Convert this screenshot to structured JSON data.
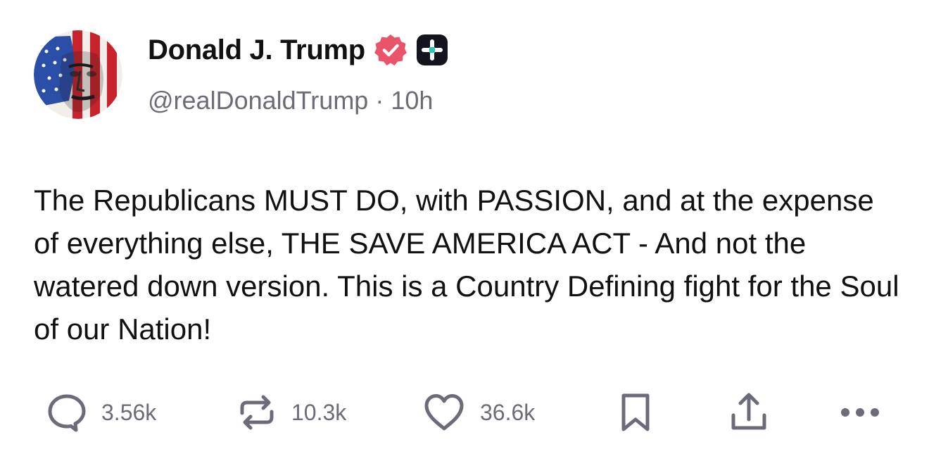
{
  "author": {
    "display_name": "Donald J. Trump",
    "handle": "@realDonaldTrump",
    "separator": "·",
    "time_ago": "10h",
    "avatar_icon": "flag-portrait-avatar",
    "verified_icon": "verified-badge-icon",
    "verified_color": "#e9546b",
    "plus_icon": "plus-badge-icon"
  },
  "post": {
    "text": "The Republicans MUST DO, with PASSION, and at the expense of everything else, THE SAVE AMERICA ACT - And not the watered down version. This is a Country Defining fight for the Soul of our Nation!"
  },
  "actions": {
    "reply": {
      "icon": "reply-bubble-icon",
      "count": "3.56k"
    },
    "repost": {
      "icon": "repost-icon",
      "count": "10.3k"
    },
    "like": {
      "icon": "heart-icon",
      "count": "36.6k"
    },
    "bookmark": {
      "icon": "bookmark-icon"
    },
    "share": {
      "icon": "share-upload-icon"
    },
    "more": {
      "icon": "more-dots-icon"
    }
  },
  "colors": {
    "text": "#111111",
    "muted": "#6c6c78",
    "icon": "#6c6c78"
  }
}
